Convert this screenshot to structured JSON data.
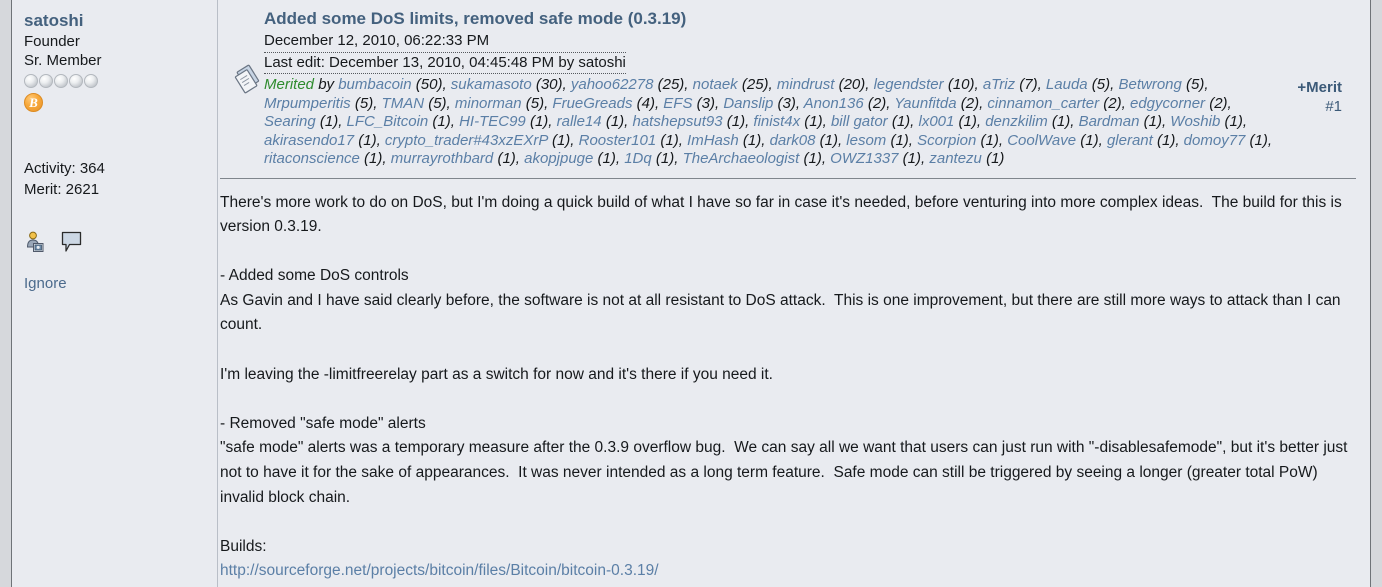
{
  "author": {
    "name": "satoshi",
    "role": "Founder",
    "rank": "Sr. Member",
    "star_count": 5,
    "badge_symbol": "B",
    "activity_label": "Activity: 364",
    "merit_label": "Merit: 2621",
    "ignore_label": "Ignore",
    "icons": [
      "user-profile-icon",
      "message-bubble-icon"
    ]
  },
  "post": {
    "title": "Added some DoS limits, removed safe mode (0.3.19)",
    "date": "December 12, 2010, 06:22:33 PM",
    "last_edit": "Last edit: December 13, 2010, 04:45:48 PM by satoshi",
    "merit_icon": "merit-stamp-icon",
    "add_merit_label": "+Merit",
    "post_number_label": "#1",
    "merited_label": "Merited",
    "merited_by_label": "by",
    "meriters": [
      {
        "name": "bumbacoin",
        "amount": "(50)"
      },
      {
        "name": "sukamasoto",
        "amount": "(30)"
      },
      {
        "name": "yahoo62278",
        "amount": "(25)"
      },
      {
        "name": "notaek",
        "amount": "(25)"
      },
      {
        "name": "mindrust",
        "amount": "(20)"
      },
      {
        "name": "legendster",
        "amount": "(10)"
      },
      {
        "name": "aTriz",
        "amount": "(7)"
      },
      {
        "name": "Lauda",
        "amount": "(5)"
      },
      {
        "name": "Betwrong",
        "amount": "(5)"
      },
      {
        "name": "Mrpumperitis",
        "amount": "(5)"
      },
      {
        "name": "TMAN",
        "amount": "(5)"
      },
      {
        "name": "minorman",
        "amount": "(5)"
      },
      {
        "name": "FrueGreads",
        "amount": "(4)"
      },
      {
        "name": "EFS",
        "amount": "(3)"
      },
      {
        "name": "Danslip",
        "amount": "(3)"
      },
      {
        "name": "Anon136",
        "amount": "(2)"
      },
      {
        "name": "Yaunfitda",
        "amount": "(2)"
      },
      {
        "name": "cinnamon_carter",
        "amount": "(2)"
      },
      {
        "name": "edgycorner",
        "amount": "(2)"
      },
      {
        "name": "Searing",
        "amount": "(1)"
      },
      {
        "name": "LFC_Bitcoin",
        "amount": "(1)"
      },
      {
        "name": "HI-TEC99",
        "amount": "(1)"
      },
      {
        "name": "ralle14",
        "amount": "(1)"
      },
      {
        "name": "hatshepsut93",
        "amount": "(1)"
      },
      {
        "name": "finist4x",
        "amount": "(1)"
      },
      {
        "name": "bill gator",
        "amount": "(1)"
      },
      {
        "name": "lx001",
        "amount": "(1)"
      },
      {
        "name": "denzkilim",
        "amount": "(1)"
      },
      {
        "name": "Bardman",
        "amount": "(1)"
      },
      {
        "name": "Woshib",
        "amount": "(1)"
      },
      {
        "name": "akirasendo17",
        "amount": "(1)"
      },
      {
        "name": "crypto_trader#43xzEXrP",
        "amount": "(1)"
      },
      {
        "name": "Rooster101",
        "amount": "(1)"
      },
      {
        "name": "ImHash",
        "amount": "(1)"
      },
      {
        "name": "dark08",
        "amount": "(1)"
      },
      {
        "name": "lesom",
        "amount": "(1)"
      },
      {
        "name": "Scorpion",
        "amount": "(1)"
      },
      {
        "name": "CoolWave",
        "amount": "(1)"
      },
      {
        "name": "glerant",
        "amount": "(1)"
      },
      {
        "name": "domoy77",
        "amount": "(1)"
      },
      {
        "name": "ritaconscience",
        "amount": "(1)"
      },
      {
        "name": "murrayrothbard",
        "amount": "(1)"
      },
      {
        "name": "akopjpuge",
        "amount": "(1)"
      },
      {
        "name": "1Dq",
        "amount": "(1)"
      },
      {
        "name": "TheArchaeologist",
        "amount": "(1)"
      },
      {
        "name": "OWZ1337",
        "amount": "(1)"
      },
      {
        "name": "zantezu",
        "amount": "(1)"
      }
    ],
    "body_part1": "There's more work to do on DoS, but I'm doing a quick build of what I have so far in case it's needed, before venturing into more complex ideas.  The build for this is version 0.3.19.\n\n- Added some DoS controls\nAs Gavin and I have said clearly before, the software is not at all resistant to DoS attack.  This is one improvement, but there are still more ways to attack than I can count.\n\nI'm leaving the -limitfreerelay part as a switch for now and it's there if you need it.\n\n- Removed \"safe mode\" alerts\n\"safe mode\" alerts was a temporary measure after the 0.3.9 overflow bug.  We can say all we want that users can just run with \"-disablesafemode\", but it's better just not to have it for the sake of appearances.  It was never intended as a long term feature.  Safe mode can still be triggered by seeing a longer (greater total PoW) invalid block chain.\n\nBuilds:\n",
    "body_link": "http://sourceforge.net/projects/bitcoin/files/Bitcoin/bitcoin-0.3.19/"
  },
  "colors": {
    "panel_bg": "#e9ebf0",
    "page_bg": "#d6d8dc",
    "link": "#5b7fa6",
    "title": "#44617e",
    "merited_green": "#2e8b2e",
    "btc_orange": "#f7a83a"
  }
}
